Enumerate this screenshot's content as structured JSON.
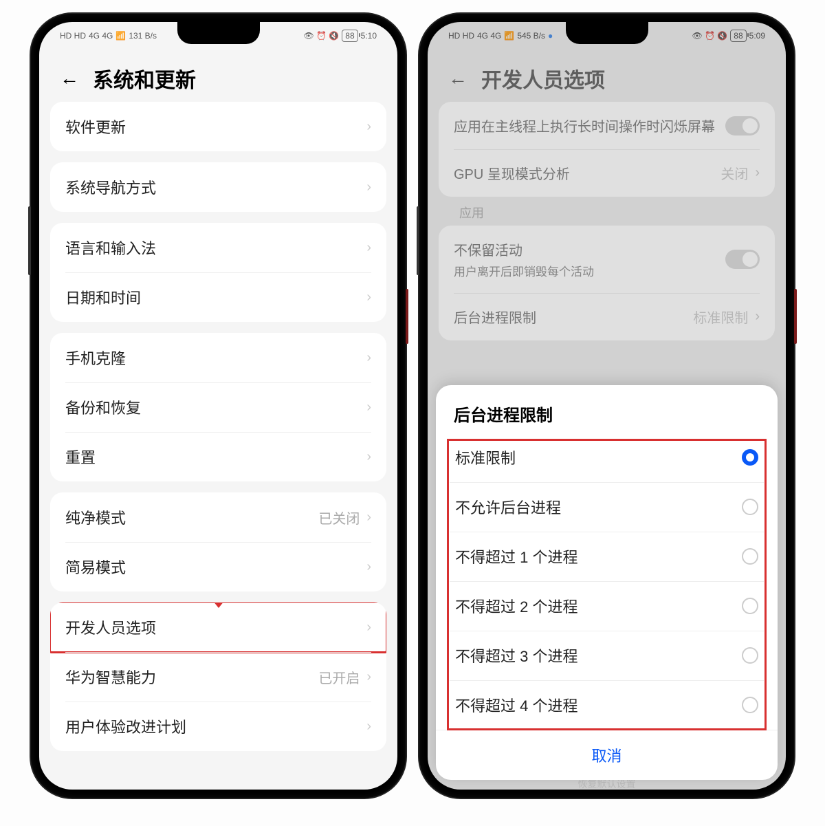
{
  "left": {
    "statusbar": {
      "sim": "HD HD",
      "net": "4G 4G",
      "wifi": "📶",
      "rate": "131 B/s",
      "icons": "👁 ⏰ 🔇",
      "battery": "88",
      "time": "5:10"
    },
    "title": "系统和更新",
    "groups": [
      {
        "rows": [
          {
            "label": "软件更新"
          }
        ]
      },
      {
        "rows": [
          {
            "label": "系统导航方式"
          }
        ]
      },
      {
        "rows": [
          {
            "label": "语言和输入法"
          },
          {
            "label": "日期和时间"
          }
        ]
      },
      {
        "rows": [
          {
            "label": "手机克隆"
          },
          {
            "label": "备份和恢复"
          },
          {
            "label": "重置"
          }
        ]
      },
      {
        "rows": [
          {
            "label": "纯净模式",
            "value": "已关闭"
          },
          {
            "label": "简易模式"
          }
        ]
      },
      {
        "rows": [
          {
            "label": "开发人员选项",
            "highlight": true,
            "arrow": true
          },
          {
            "label": "华为智慧能力",
            "value": "已开启"
          },
          {
            "label": "用户体验改进计划"
          }
        ]
      }
    ]
  },
  "right": {
    "statusbar": {
      "sim": "HD HD",
      "net": "4G 4G",
      "wifi": "📶",
      "rate": "545 B/s",
      "blue": "●",
      "icons": "👁 ⏰ 🔇",
      "battery": "88",
      "time": "5:09"
    },
    "title": "开发人员选项",
    "topRows": [
      {
        "label": "应用在主线程上执行长时间操作时闪烁屏幕",
        "toggle": true
      },
      {
        "label": "GPU 呈现模式分析",
        "value": "关闭"
      }
    ],
    "sectionTitle": "应用",
    "appRows": [
      {
        "label": "不保留活动",
        "sub": "用户离开后即销毁每个活动",
        "toggle": true
      },
      {
        "label": "后台进程限制",
        "value": "标准限制"
      }
    ],
    "sheet": {
      "title": "后台进程限制",
      "options": [
        {
          "label": "标准限制",
          "selected": true
        },
        {
          "label": "不允许后台进程"
        },
        {
          "label": "不得超过 1 个进程"
        },
        {
          "label": "不得超过 2 个进程"
        },
        {
          "label": "不得超过 3 个进程"
        },
        {
          "label": "不得超过 4 个进程"
        }
      ],
      "cancel": "取消"
    },
    "below": "恢复默认设置"
  }
}
